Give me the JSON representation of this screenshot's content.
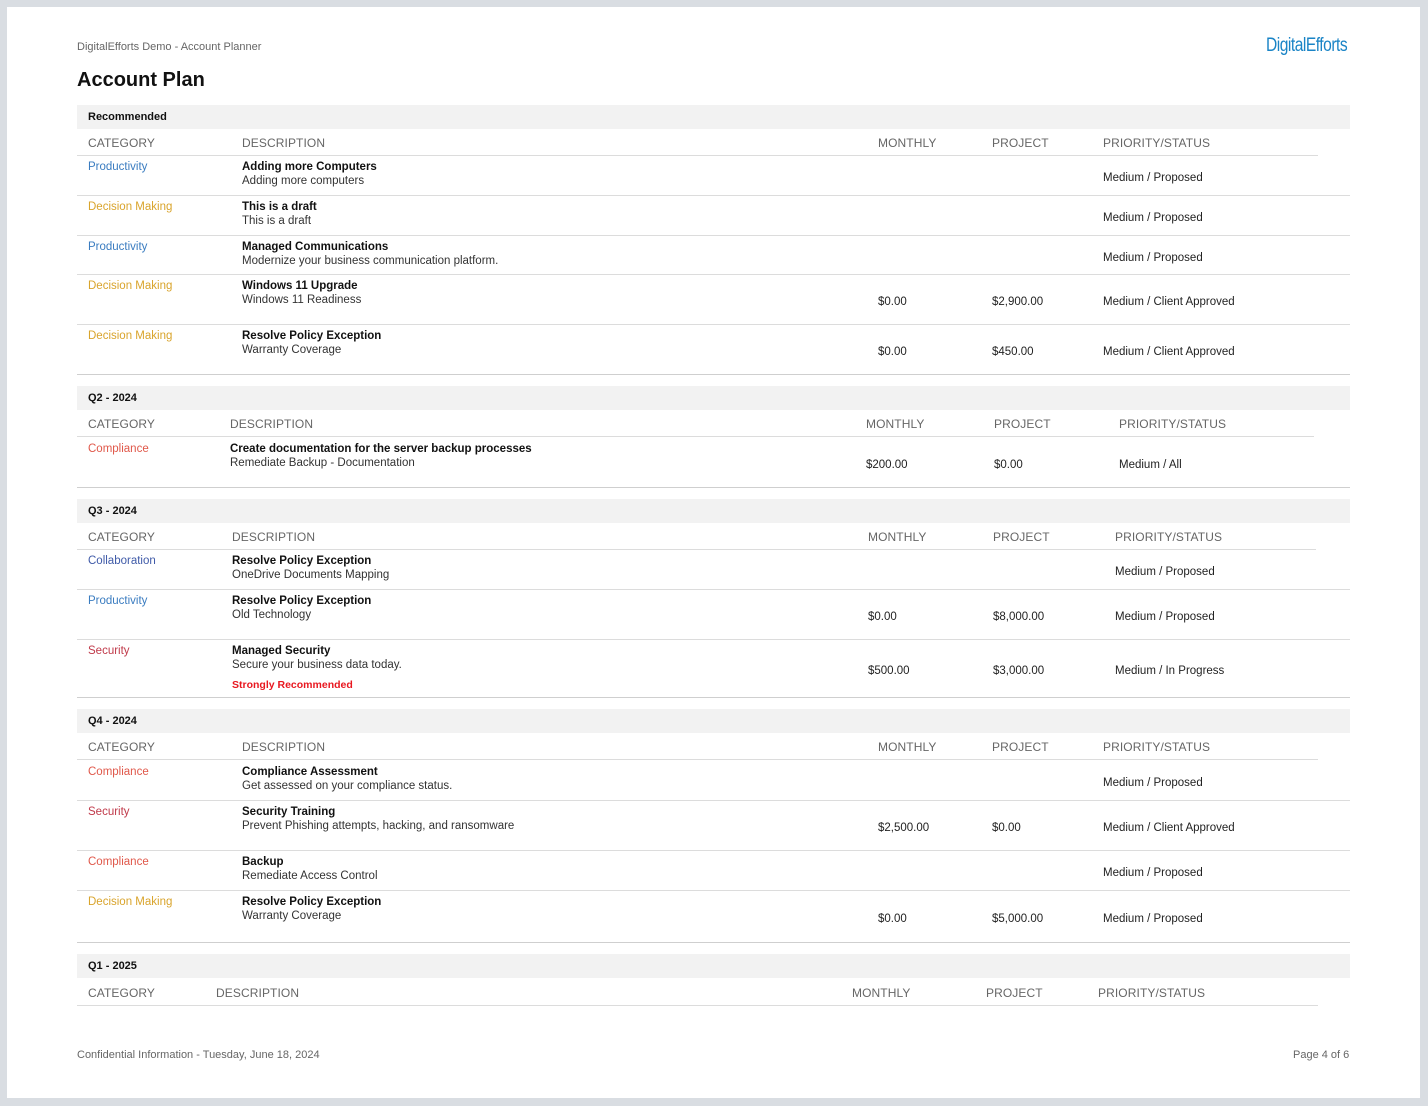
{
  "header": {
    "app_title": "DigitalEfforts Demo - Account Planner",
    "logo_text": "DigitalEfforts",
    "page_title": "Account Plan"
  },
  "colors": {
    "Productivity": "#3a7cc0",
    "Decision Making": "#d9a42c",
    "Compliance": "#e0584a",
    "Collaboration": "#3f5aa8",
    "Security": "#c03a4a",
    "logo": "#1a84c6"
  },
  "columns": {
    "category": "CATEGORY",
    "description": "DESCRIPTION",
    "monthly": "MONTHLY",
    "project": "PROJECT",
    "priority_status": "PRIORITY/STATUS"
  },
  "sections": [
    {
      "name": "Recommended",
      "rows": [
        {
          "category": "Productivity",
          "title": "Adding more Computers",
          "subtitle": "Adding more computers",
          "monthly": "",
          "project": "",
          "status": "Medium / Proposed",
          "note": ""
        },
        {
          "category": "Decision Making",
          "title": "This is a draft",
          "subtitle": "This is a draft",
          "monthly": "",
          "project": "",
          "status": "Medium / Proposed",
          "note": ""
        },
        {
          "category": "Productivity",
          "title": "Managed Communications",
          "subtitle": "Modernize your business communication platform.",
          "monthly": "",
          "project": "",
          "status": "Medium / Proposed",
          "note": ""
        },
        {
          "category": "Decision Making",
          "title": "Windows 11 Upgrade",
          "subtitle": "Windows 11 Readiness",
          "monthly": "$0.00",
          "project": "$2,900.00",
          "status": "Medium / Client Approved",
          "note": ""
        },
        {
          "category": "Decision Making",
          "title": "Resolve Policy Exception",
          "subtitle": "Warranty Coverage",
          "monthly": "$0.00",
          "project": "$450.00",
          "status": "Medium / Client Approved",
          "note": ""
        }
      ]
    },
    {
      "name": "Q2 - 2024",
      "rows": [
        {
          "category": "Compliance",
          "title": "Create documentation for the server backup processes",
          "subtitle": "Remediate Backup - Documentation",
          "monthly": "$200.00",
          "project": "$0.00",
          "status": "Medium / All",
          "note": ""
        }
      ]
    },
    {
      "name": "Q3 - 2024",
      "rows": [
        {
          "category": "Collaboration",
          "title": "Resolve Policy Exception",
          "subtitle": "OneDrive Documents Mapping",
          "monthly": "",
          "project": "",
          "status": "Medium / Proposed",
          "note": ""
        },
        {
          "category": "Productivity",
          "title": "Resolve Policy Exception",
          "subtitle": "Old Technology",
          "monthly": "$0.00",
          "project": "$8,000.00",
          "status": "Medium / Proposed",
          "note": ""
        },
        {
          "category": "Security",
          "title": "Managed Security",
          "subtitle": "Secure your business data today.",
          "monthly": "$500.00",
          "project": "$3,000.00",
          "status": "Medium / In Progress",
          "note": "Strongly Recommended"
        }
      ]
    },
    {
      "name": "Q4 - 2024",
      "rows": [
        {
          "category": "Compliance",
          "title": "Compliance Assessment",
          "subtitle": "Get assessed on your compliance status.",
          "monthly": "",
          "project": "",
          "status": "Medium / Proposed",
          "note": ""
        },
        {
          "category": "Security",
          "title": "Security Training",
          "subtitle": "Prevent Phishing attempts, hacking, and ransomware",
          "monthly": "$2,500.00",
          "project": "$0.00",
          "status": "Medium / Client Approved",
          "note": ""
        },
        {
          "category": "Compliance",
          "title": "Backup",
          "subtitle": "Remediate Access Control",
          "monthly": "",
          "project": "",
          "status": "Medium / Proposed",
          "note": ""
        },
        {
          "category": "Decision Making",
          "title": "Resolve Policy Exception",
          "subtitle": "Warranty Coverage",
          "monthly": "$0.00",
          "project": "$5,000.00",
          "status": "Medium / Proposed",
          "note": ""
        }
      ]
    },
    {
      "name": "Q1 - 2025",
      "rows": []
    }
  ],
  "footer": {
    "confidential": "Confidential Information - Tuesday, June 18, 2024",
    "page_number": "Page 4 of 6"
  }
}
